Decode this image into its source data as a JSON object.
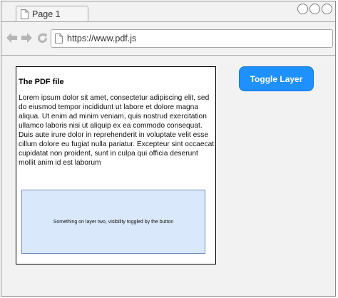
{
  "tab": {
    "label": "Page 1"
  },
  "toolbar": {
    "url": "https://www.pdf.js"
  },
  "pdf": {
    "title": "The PDF file",
    "body": "Lorem ipsum dolor sit amet, consectetur adipiscing elit, sed do eiusmod tempor incididunt ut labore et dolore magna aliqua. Ut enim ad minim veniam, quis nostrud exercitation ullamco laboris nisi ut aliquip ex ea commodo consequat. Duis aute irure dolor in reprehenderit in voluptate velit esse cillum dolore eu fugiat nulla pariatur. Excepteur sint occaecat cupidatat non proident, sunt in culpa qui officia deserunt mollit anim id est laborum",
    "layer_two_text": "Something on layer two, visibility toggled by the button"
  },
  "buttons": {
    "toggle_label": "Toggle Layer"
  },
  "icons": {
    "tab": "document-icon",
    "back": "arrow-left-icon",
    "forward": "arrow-right-icon",
    "reload": "reload-icon",
    "url": "document-icon",
    "window_controls": [
      "circle-icon",
      "circle-icon",
      "circle-icon"
    ]
  },
  "colors": {
    "toggle_button": "#1e90ff",
    "layer_two_fill": "#dae8fc",
    "layer_two_border": "#6c8ebf"
  }
}
